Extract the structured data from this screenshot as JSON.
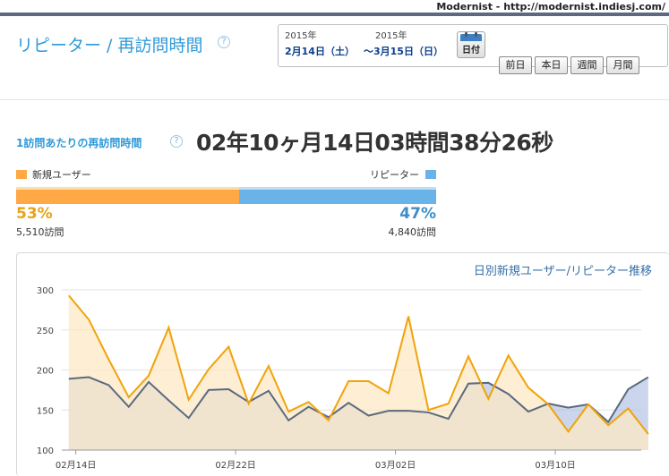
{
  "watermark": "Modernist - http://modernist.indiesj.com/",
  "page": {
    "title": "リピーター / 再訪問時間",
    "help": "?"
  },
  "date_range": {
    "start_year": "2015年",
    "start_day": "2月14日（土）",
    "end_year": "2015年",
    "end_day": "～3月15日（日）",
    "calendar_label": "日付",
    "buttons": [
      "前日",
      "本日",
      "週間",
      "月間"
    ]
  },
  "stat": {
    "label": "1訪問あたりの再訪問時間",
    "help": "?",
    "value": "02年10ヶ月14日03時間38分26秒"
  },
  "ratio": {
    "new_label": "新規ユーザー",
    "repeater_label": "リピーター",
    "new_pct": "53%",
    "repeater_pct": "47%",
    "new_fraction": 0.53,
    "new_visits": "5,510訪問",
    "repeater_visits": "4,840訪問",
    "colors": {
      "new": "#fea846",
      "repeater": "#69b3e9"
    }
  },
  "chart_data": {
    "type": "area",
    "title": "日別新規ユーザー/リピーター推移",
    "ylim": [
      100,
      300
    ],
    "yticks": [
      100,
      150,
      200,
      250,
      300
    ],
    "xlim": [
      0,
      29
    ],
    "xtick_labels": [
      {
        "index": 0,
        "label": "02月14日"
      },
      {
        "index": 8,
        "label": "02月22日"
      },
      {
        "index": 16,
        "label": "03月02日"
      },
      {
        "index": 24,
        "label": "03月10日"
      }
    ],
    "grid": true,
    "series": [
      {
        "color": "#f0a30a",
        "fill": "#fde8c4",
        "values": [
          293,
          263,
          213,
          166,
          193,
          253,
          163,
          201,
          229,
          158,
          205,
          148,
          160,
          137,
          186,
          186,
          171,
          267,
          150,
          158,
          217,
          164,
          218,
          178,
          157,
          123,
          157,
          131,
          152,
          120
        ]
      },
      {
        "color": "#5a6a80",
        "fill": "#a8bbe0",
        "values": [
          189,
          191,
          181,
          154,
          185,
          162,
          140,
          175,
          176,
          160,
          174,
          137,
          154,
          141,
          159,
          143,
          149,
          149,
          147,
          139,
          183,
          184,
          170,
          148,
          158,
          153,
          157,
          135,
          176,
          191
        ]
      }
    ]
  }
}
